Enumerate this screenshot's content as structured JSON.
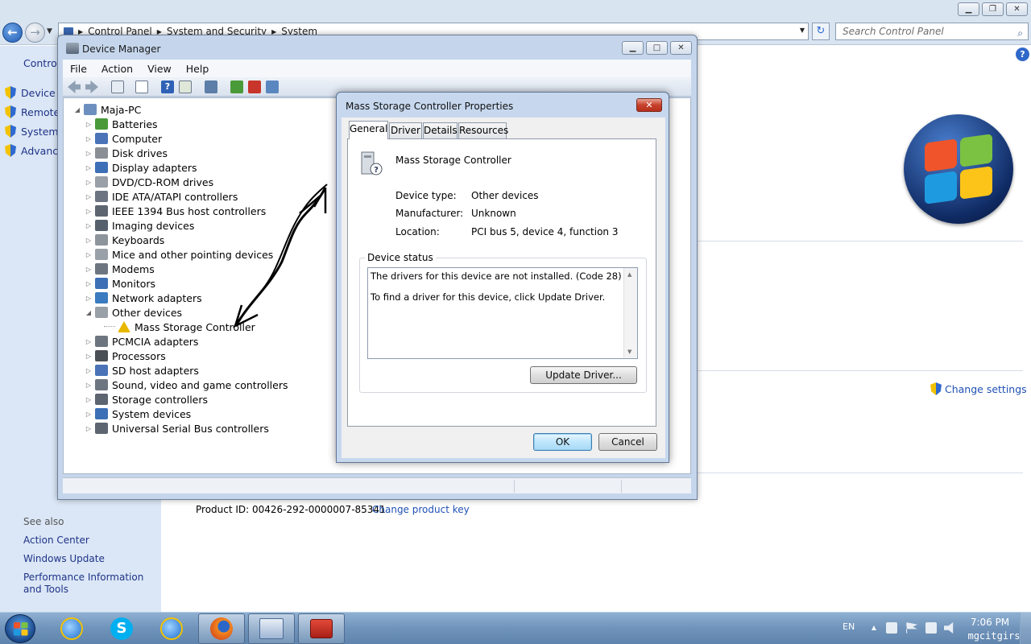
{
  "control_panel": {
    "breadcrumbs": [
      "Control Panel",
      "System and Security",
      "System"
    ],
    "search_placeholder": "Search Control Panel",
    "left_title": "Control",
    "left_items": [
      "Device M",
      "Remote",
      "System",
      "Advance"
    ],
    "see_also_title": "See also",
    "see_also_links": [
      "Action Center",
      "Windows Update",
      "Performance Information and Tools"
    ],
    "change_settings": "Change settings",
    "product_id_label": "Product ID: 00426-292-0000007-85341",
    "change_product_key": "Change product key"
  },
  "device_manager": {
    "title": "Device Manager",
    "menu": [
      "File",
      "Action",
      "View",
      "Help"
    ],
    "root": "Maja-PC",
    "tree": [
      {
        "label": "Batteries",
        "icon": "battery-icon",
        "color": "#4a9a3a"
      },
      {
        "label": "Computer",
        "icon": "computer-icon",
        "color": "#4a73b8"
      },
      {
        "label": "Disk drives",
        "icon": "disk-icon",
        "color": "#8a8f96"
      },
      {
        "label": "Display adapters",
        "icon": "display-icon",
        "color": "#3d6fb6"
      },
      {
        "label": "DVD/CD-ROM drives",
        "icon": "dvd-icon",
        "color": "#9aa0a8"
      },
      {
        "label": "IDE ATA/ATAPI controllers",
        "icon": "ide-icon",
        "color": "#6b7480"
      },
      {
        "label": "IEEE 1394 Bus host controllers",
        "icon": "ieee1394-icon",
        "color": "#5c6570"
      },
      {
        "label": "Imaging devices",
        "icon": "camera-icon",
        "color": "#55606c"
      },
      {
        "label": "Keyboards",
        "icon": "keyboard-icon",
        "color": "#8d949c"
      },
      {
        "label": "Mice and other pointing devices",
        "icon": "mouse-icon",
        "color": "#9aa0a8"
      },
      {
        "label": "Modems",
        "icon": "modem-icon",
        "color": "#6d7680"
      },
      {
        "label": "Monitors",
        "icon": "monitor-icon",
        "color": "#3d6fb6"
      },
      {
        "label": "Network adapters",
        "icon": "network-icon",
        "color": "#3b7bbf"
      },
      {
        "label": "Other devices",
        "icon": "unknown-device-icon",
        "color": "#9aa0a8"
      },
      {
        "label": "Mass Storage Controller",
        "icon": "warning-device-icon",
        "color": "#e8b800",
        "child": true
      },
      {
        "label": "PCMCIA adapters",
        "icon": "pcmcia-icon",
        "color": "#6d7680"
      },
      {
        "label": "Processors",
        "icon": "processor-icon",
        "color": "#4a4f56"
      },
      {
        "label": "SD host adapters",
        "icon": "sd-icon",
        "color": "#4a73b8"
      },
      {
        "label": "Sound, video and game controllers",
        "icon": "speaker-icon",
        "color": "#6d7680"
      },
      {
        "label": "Storage controllers",
        "icon": "storage-icon",
        "color": "#5c6570"
      },
      {
        "label": "System devices",
        "icon": "system-icon",
        "color": "#3d6fb6"
      },
      {
        "label": "Universal Serial Bus controllers",
        "icon": "usb-icon",
        "color": "#5c6570"
      }
    ]
  },
  "properties": {
    "title": "Mass Storage Controller Properties",
    "tabs": [
      "General",
      "Driver",
      "Details",
      "Resources"
    ],
    "device_name": "Mass Storage Controller",
    "device_type_label": "Device type:",
    "device_type": "Other devices",
    "manufacturer_label": "Manufacturer:",
    "manufacturer": "Unknown",
    "location_label": "Location:",
    "location": "PCI bus 5, device 4, function 3",
    "status_group": "Device status",
    "status_line1": "The drivers for this device are not installed. (Code 28)",
    "status_line2": "To find a driver for this device, click Update Driver.",
    "update_driver": "Update Driver...",
    "ok": "OK",
    "cancel": "Cancel"
  },
  "taskbar": {
    "language": "EN",
    "time": "7:06 PM",
    "user": "mgcitgirs"
  },
  "colors": {
    "link": "#1e50b5",
    "nav_link": "#1e3287",
    "taskbar": "#6f93ba"
  }
}
